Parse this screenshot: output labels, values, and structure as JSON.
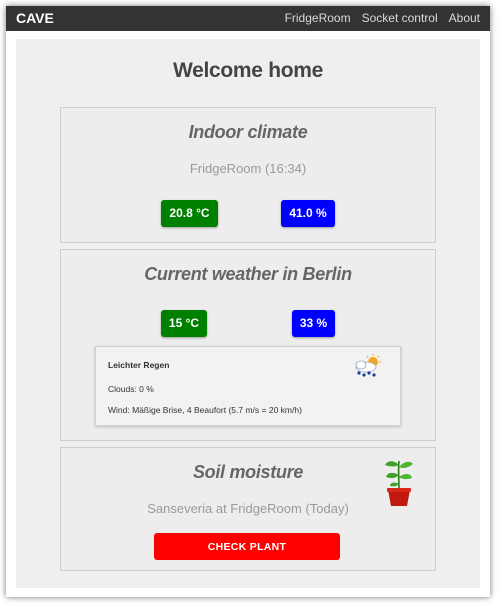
{
  "nav": {
    "brand": "CAVE",
    "links": [
      "FridgeRoom",
      "Socket control",
      "About"
    ]
  },
  "page": {
    "title": "Welcome home"
  },
  "indoor": {
    "title": "Indoor climate",
    "location": "FridgeRoom (16:34)",
    "temperature": "20.8 °C",
    "humidity": "41.0 %"
  },
  "weather": {
    "title": "Current weather in Berlin",
    "temperature": "15 °C",
    "humidity": "33 %",
    "description": "Leichter Regen",
    "clouds": "Clouds: 0 %",
    "wind": "Wind: Mäßige Brise, 4 Beaufort (5.7 m/s = 20 km/h)",
    "icon": "light-rain-icon"
  },
  "soil": {
    "title": "Soil moisture",
    "plant": "Sanseveria at FridgeRoom (Today)",
    "button": "CHECK PLANT",
    "icon": "potted-plant-icon"
  },
  "colors": {
    "navbar": "#333333",
    "temperature_badge": "#008000",
    "humidity_badge": "#0000ff",
    "check_button": "#ff0000"
  }
}
